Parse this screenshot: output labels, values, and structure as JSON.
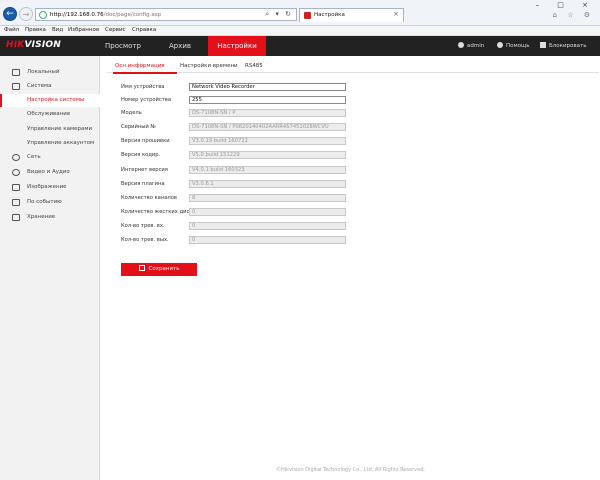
{
  "browser": {
    "address_host": "http://192.168.0.76",
    "address_path": "/doc/page/config.asp",
    "address_tools": "⌕ ▾ ↻",
    "tab_title": "Настройка",
    "tab_close": "×",
    "window_controls": "– □ ×",
    "right_tools": "⌂ ☆ ⚙",
    "back_glyph": "←",
    "forward_glyph": "→"
  },
  "menu": [
    "Файл",
    "Правка",
    "Вид",
    "Избранное",
    "Сервис",
    "Справка"
  ],
  "header": {
    "logo_red": "HIK",
    "logo_white": "VISION",
    "nav": [
      "Просмотр",
      "Архив",
      "Настройки"
    ],
    "user": "admin",
    "help": "Помощь",
    "lock": "Блокировать"
  },
  "sidebar": {
    "items": [
      {
        "label": "Локальный",
        "icon": "monitor-icon"
      },
      {
        "label": "Система",
        "icon": "system-icon"
      },
      {
        "label": "Сеть",
        "icon": "globe-icon"
      },
      {
        "label": "Видео и Аудио",
        "icon": "video-audio-icon"
      },
      {
        "label": "Изображение",
        "icon": "image-icon"
      },
      {
        "label": "По событию",
        "icon": "event-icon"
      },
      {
        "label": "Хранение",
        "icon": "storage-icon"
      }
    ],
    "system_subitems": [
      "Настройка системы",
      "Обслуживание",
      "Управление камерами",
      "Управление аккаунтом"
    ]
  },
  "tabs": [
    "Осн.информация",
    "Настройки времени",
    "RS485"
  ],
  "fields": [
    {
      "label": "Имя устройства",
      "value": "Network Video Recorder",
      "editable": true
    },
    {
      "label": "Номер устройства",
      "value": "255",
      "editable": true
    },
    {
      "label": "Модель",
      "value": "DS-7108N-SN / P",
      "editable": false
    },
    {
      "label": "Серийный №",
      "value": "DS-7108N-SN / P0820140402AARR457451028WCVU",
      "editable": false
    },
    {
      "label": "Версия прошивки",
      "value": "V3.0.19 build 160722",
      "editable": false
    },
    {
      "label": "Версия кодир.",
      "value": "V5.0 build 151229",
      "editable": false
    },
    {
      "label": "Интернет версия",
      "value": "V4.0.1 build 160323",
      "editable": false
    },
    {
      "label": "Версия плагина",
      "value": "V3.0.6.1",
      "editable": false
    },
    {
      "label": "Количество каналов",
      "value": "8",
      "editable": false
    },
    {
      "label": "Количество жестких дис.",
      "value": "0",
      "editable": false
    },
    {
      "label": "Кол-во трев. вх.",
      "value": "0",
      "editable": false
    },
    {
      "label": "Кол-во трев. вых.",
      "value": "0",
      "editable": false
    }
  ],
  "save_label": "Сохранить",
  "footer": "©Hikvision Digital Technology Co., Ltd. All Rights Reserved.",
  "colors": {
    "accent": "#e3101a",
    "header_bg": "#222222",
    "sidebar_bg": "#f2f2f2"
  }
}
